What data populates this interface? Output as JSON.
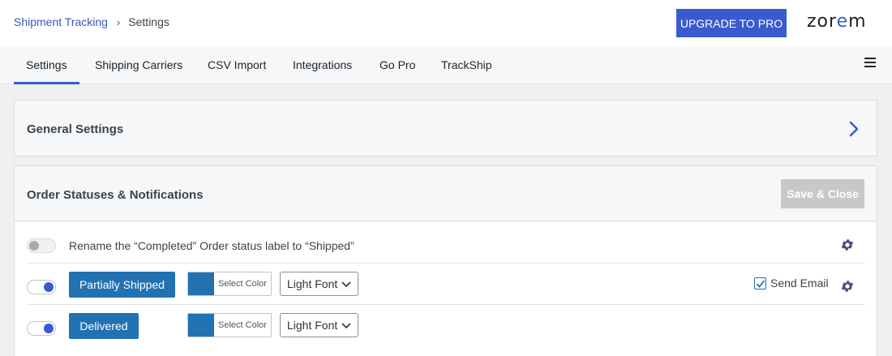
{
  "breadcrumb": {
    "parent": "Shipment Tracking",
    "separator": "›",
    "current": "Settings"
  },
  "header": {
    "upgrade_label": "UPGRADE TO PRO",
    "logo_prefix": "zor",
    "logo_accent": "e",
    "logo_suffix": "m"
  },
  "tabs": [
    {
      "label": "Settings",
      "active": true
    },
    {
      "label": "Shipping Carriers",
      "active": false
    },
    {
      "label": "CSV Import",
      "active": false
    },
    {
      "label": "Integrations",
      "active": false
    },
    {
      "label": "Go Pro",
      "active": false
    },
    {
      "label": "TrackShip",
      "active": false
    }
  ],
  "general_settings": {
    "title": "General Settings",
    "icon": "chevron-right-icon"
  },
  "order_statuses": {
    "title": "Order Statuses & Notifications",
    "save_label": "Save & Close",
    "rows": [
      {
        "toggle": "off",
        "label": "Rename the “Completed” Order status label to “Shipped”",
        "icon": "gear-icon"
      },
      {
        "toggle": "on",
        "status_label": "Partially Shipped",
        "color_label": "Select Color",
        "font_label": "Light Font",
        "send_email_label": "Send Email",
        "send_email_checked": true,
        "icon": "gear-icon"
      },
      {
        "toggle": "on",
        "status_label": "Delivered",
        "color_label": "Select Color",
        "font_label": "Light Font"
      }
    ]
  },
  "colors": {
    "accent": "#3a5bd0",
    "status_button": "#2271b1",
    "disabled_button": "#c7c8ca"
  }
}
